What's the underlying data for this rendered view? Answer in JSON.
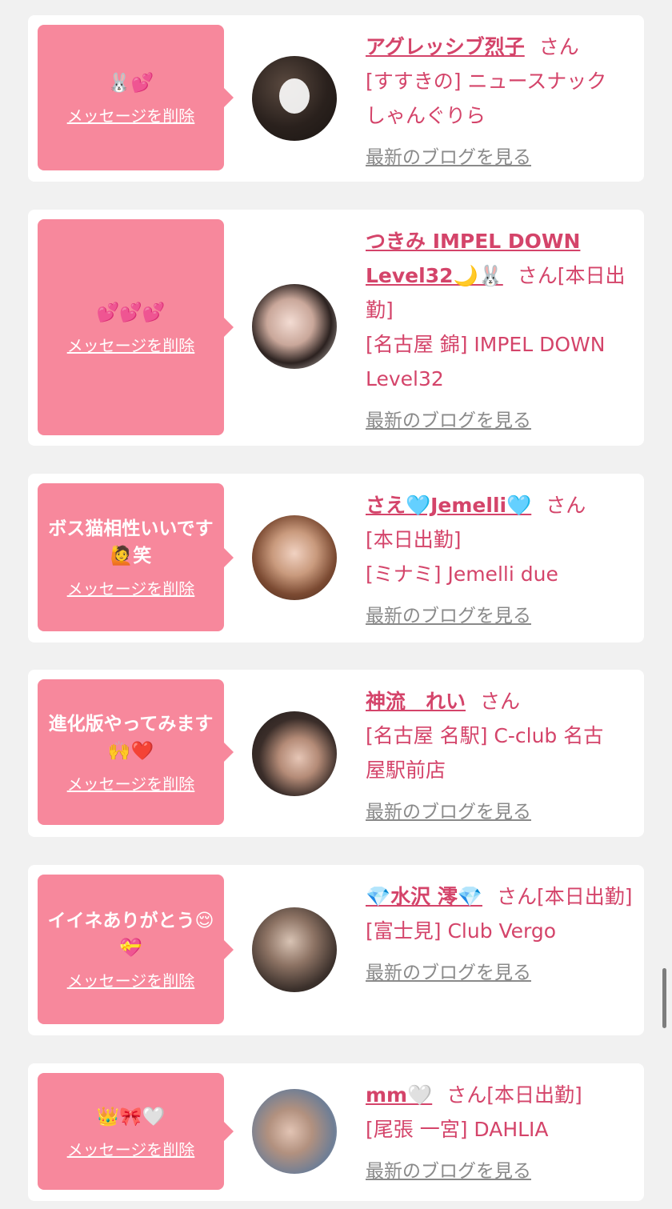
{
  "common": {
    "delete_label": "メッセージを削除",
    "blog_label": "最新のブログを見る",
    "san": "さん"
  },
  "cards": [
    {
      "message": "🐰💕",
      "name": "アグレッシブ烈子",
      "status": "",
      "shop": "[すすきの] ニュースナック しゃんぐりら"
    },
    {
      "message": "💕💕💕",
      "name": "つきみ IMPEL DOWN Level32🌙🐰",
      "status": "[本日出勤]",
      "shop": "[名古屋 錦] IMPEL DOWN Level32"
    },
    {
      "message": "ボス猫相性いいです🙋笑",
      "name": "さえ🩵Jemelli🩵",
      "status": "",
      "shop": "[本日出勤]\n[ミナミ] Jemelli due"
    },
    {
      "message": "進化版やってみます🙌❤️",
      "name": "神流　れい",
      "status": "",
      "shop": "[名古屋 名駅] C-club 名古屋駅前店"
    },
    {
      "message": "イイネありがとう😌💝",
      "name": "💎水沢 澪💎",
      "status": "[本日出勤]",
      "shop": "[富士見] Club Vergo"
    },
    {
      "message": "👑🎀🤍",
      "name": "mm🤍",
      "status": "[本日出勤]",
      "shop": "[尾張 一宮] DAHLIA"
    }
  ]
}
